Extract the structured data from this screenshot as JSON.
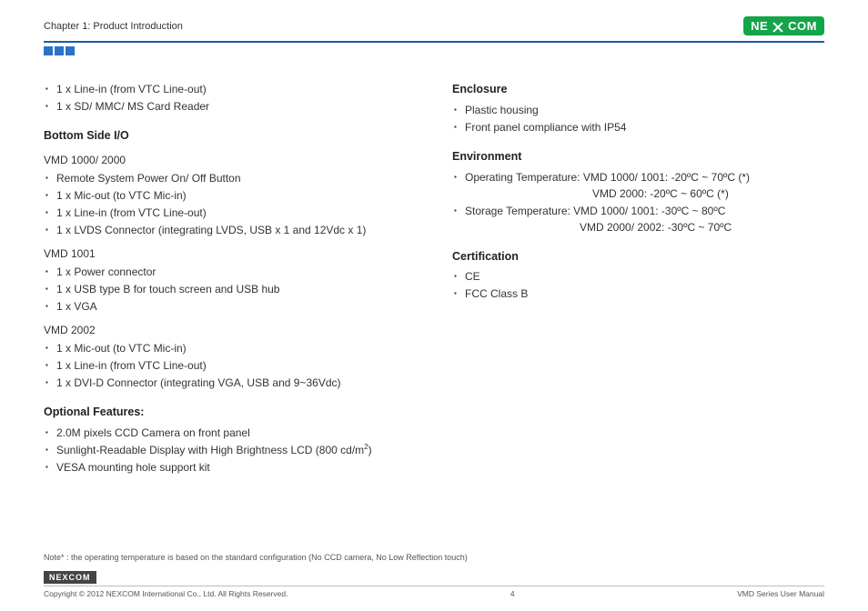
{
  "header": {
    "chapter": "Chapter 1: Product Introduction",
    "logo_left": "NE",
    "logo_right": "COM"
  },
  "left": {
    "top_items": [
      "1 x Line-in (from VTC Line-out)",
      "1 x SD/ MMC/ MS Card Reader"
    ],
    "bottom_side_title": "Bottom Side I/O",
    "vmd1000_head": "VMD 1000/ 2000",
    "vmd1000_items": [
      "Remote System Power On/ Off Button",
      "1 x Mic-out (to VTC Mic-in)",
      "1 x Line-in (from VTC Line-out)",
      "1 x LVDS Connector (integrating LVDS, USB x 1 and 12Vdc x 1)"
    ],
    "vmd1001_head": "VMD 1001",
    "vmd1001_items": [
      "1 x Power connector",
      "1 x USB type B for touch screen and USB hub",
      "1 x VGA"
    ],
    "vmd2002_head": "VMD 2002",
    "vmd2002_items": [
      "1 x Mic-out (to VTC Mic-in)",
      "1 x Line-in (from VTC Line-out)",
      "1 x DVI-D Connector (integrating VGA, USB and 9~36Vdc)"
    ],
    "optional_title": "Optional Features:",
    "optional_items": [
      "2.0M pixels CCD Camera on front panel",
      "Sunlight-Readable Display with High Brightness LCD (800 cd/m",
      "VESA mounting hole support kit"
    ],
    "opt_unit_sup": "2",
    "opt_unit_close": ")"
  },
  "right": {
    "enclosure_title": "Enclosure",
    "enclosure_items": [
      "Plastic housing",
      "Front panel compliance with IP54"
    ],
    "env_title": "Environment",
    "env_op_label": "Operating Temperature: VMD 1000/ 1001: -20ºC ~ 70ºC (*)",
    "env_op_line2": "VMD 2000: -20ºC ~ 60ºC (*)",
    "env_st_label": "Storage Temperature: VMD 1000/ 1001: -30ºC ~ 80ºC",
    "env_st_line2": "VMD 2000/ 2002: -30ºC ~ 70ºC",
    "cert_title": "Certification",
    "cert_items": [
      "CE",
      "FCC Class B"
    ]
  },
  "note": "Note* : the operating temperature is based on the standard configuration (No CCD camera, No Low Reflection touch)",
  "footer": {
    "logo": "NEXCOM",
    "copyright": "Copyright © 2012 NEXCOM International Co., Ltd. All Rights Reserved.",
    "page": "4",
    "manual": "VMD Series User Manual"
  }
}
